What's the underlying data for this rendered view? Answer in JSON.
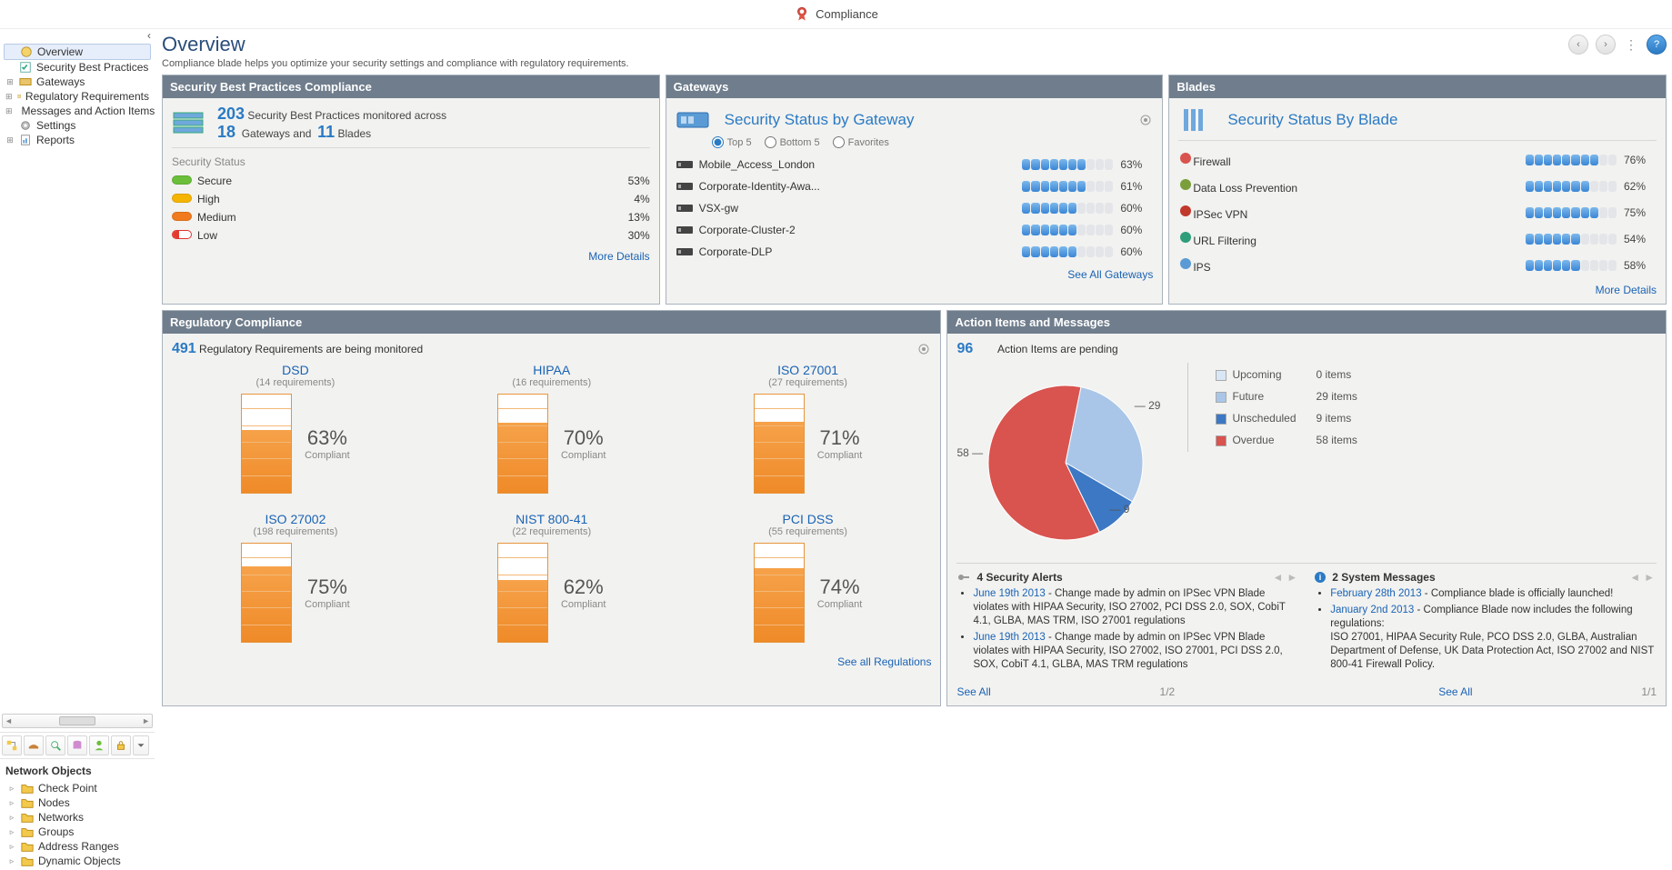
{
  "app": {
    "title": "Compliance"
  },
  "nav": {
    "items": [
      {
        "label": "Overview",
        "selected": true
      },
      {
        "label": "Security Best Practices"
      },
      {
        "label": "Gateways"
      },
      {
        "label": "Regulatory Requirements"
      },
      {
        "label": "Messages and Action Items"
      },
      {
        "label": "Settings"
      },
      {
        "label": "Reports"
      }
    ]
  },
  "network_objects": {
    "heading": "Network Objects",
    "items": [
      "Check Point",
      "Nodes",
      "Networks",
      "Groups",
      "Address Ranges",
      "Dynamic Objects"
    ]
  },
  "page": {
    "title": "Overview",
    "subtitle": "Compliance blade helps you optimize your security settings and compliance with regulatory requirements."
  },
  "sbp": {
    "panel_title": "Security Best Practices Compliance",
    "count": "203",
    "count_text": "Security Best Practices monitored across",
    "gateways": "18",
    "gateways_text": "Gateways and",
    "blades": "11",
    "blades_text": "Blades",
    "status_label": "Security Status",
    "rows": [
      {
        "label": "Secure",
        "pct": "53%",
        "cls": "green"
      },
      {
        "label": "High",
        "pct": "4%",
        "cls": "yellow"
      },
      {
        "label": "Medium",
        "pct": "13%",
        "cls": "orange"
      },
      {
        "label": "Low",
        "pct": "30%",
        "cls": "red-low"
      }
    ],
    "more": "More Details"
  },
  "gateways": {
    "panel_title": "Gateways",
    "subtitle": "Security Status by Gateway",
    "filters": {
      "top5": "Top 5",
      "bottom5": "Bottom 5",
      "favorites": "Favorites"
    },
    "rows": [
      {
        "name": "Mobile_Access_London",
        "pct": "63%",
        "seg": 7
      },
      {
        "name": "Corporate-Identity-Awa...",
        "pct": "61%",
        "seg": 7
      },
      {
        "name": "VSX-gw",
        "pct": "60%",
        "seg": 6
      },
      {
        "name": "Corporate-Cluster-2",
        "pct": "60%",
        "seg": 6
      },
      {
        "name": "Corporate-DLP",
        "pct": "60%",
        "seg": 6
      }
    ],
    "link": "See All Gateways"
  },
  "blades": {
    "panel_title": "Blades",
    "subtitle": "Security Status By Blade",
    "rows": [
      {
        "name": "Firewall",
        "pct": "76%",
        "seg": 8,
        "color": "#d9534f"
      },
      {
        "name": "Data Loss Prevention",
        "pct": "62%",
        "seg": 7,
        "color": "#7a9e3a"
      },
      {
        "name": "IPSec VPN",
        "pct": "75%",
        "seg": 8,
        "color": "#c0392b"
      },
      {
        "name": "URL Filtering",
        "pct": "54%",
        "seg": 6,
        "color": "#2e9e7a"
      },
      {
        "name": "IPS",
        "pct": "58%",
        "seg": 6,
        "color": "#5b9bd5"
      }
    ],
    "link": "More Details"
  },
  "regulatory": {
    "panel_title": "Regulatory Compliance",
    "count": "491",
    "count_text": "Regulatory Requirements are being monitored",
    "items": [
      {
        "name": "DSD",
        "req": "(14 requirements)",
        "pct": 63,
        "pct_label": "63%",
        "sub": "Compliant"
      },
      {
        "name": "HIPAA",
        "req": "(16 requirements)",
        "pct": 70,
        "pct_label": "70%",
        "sub": "Compliant"
      },
      {
        "name": "ISO 27001",
        "req": "(27 requirements)",
        "pct": 71,
        "pct_label": "71%",
        "sub": "Compliant"
      },
      {
        "name": "ISO 27002",
        "req": "(198 requirements)",
        "pct": 75,
        "pct_label": "75%",
        "sub": "Compliant"
      },
      {
        "name": "NIST 800-41",
        "req": "(22 requirements)",
        "pct": 62,
        "pct_label": "62%",
        "sub": "Compliant"
      },
      {
        "name": "PCI DSS",
        "req": "(55 requirements)",
        "pct": 74,
        "pct_label": "74%",
        "sub": "Compliant"
      }
    ],
    "link": "See all Regulations"
  },
  "action_items": {
    "panel_title": "Action Items and Messages",
    "count": "96",
    "count_text": "Action Items are pending",
    "legend": [
      {
        "name": "Upcoming",
        "value": "0 items",
        "color": "#d9e6f5"
      },
      {
        "name": "Future",
        "value": "29 items",
        "color": "#a9c6e8"
      },
      {
        "name": "Unscheduled",
        "value": "9 items",
        "color": "#3c78c3"
      },
      {
        "name": "Overdue",
        "value": "58 items",
        "color": "#d9534f"
      }
    ],
    "pie_labels": {
      "future": "29",
      "unscheduled": "9",
      "overdue": "58"
    },
    "alerts": {
      "title": "4 Security Alerts",
      "items": [
        {
          "date": "June 19th 2013",
          "text": "Change made by admin on IPSec VPN Blade violates with HIPAA Security, ISO 27002, PCI DSS 2.0, SOX, CobiT 4.1, GLBA, MAS TRM, ISO 27001 regulations"
        },
        {
          "date": "June 19th 2013",
          "text": "Change made by admin on IPSec VPN Blade violates with HIPAA Security, ISO 27002, ISO 27001, PCI DSS 2.0, SOX, CobiT 4.1, GLBA, MAS TRM regulations"
        }
      ],
      "page": "1/2",
      "see_all": "See All"
    },
    "messages": {
      "title": "2 System Messages",
      "items": [
        {
          "date": "February 28th 2013",
          "text": "Compliance blade is officially launched!"
        },
        {
          "date": "January 2nd 2013",
          "text": "Compliance Blade now includes the following regulations:\nISO 27001, HIPAA Security Rule, PCO DSS 2.0, GLBA, Australian Department of Defense, UK Data Protection Act, ISO 27002 and NIST 800-41 Firewall Policy."
        }
      ],
      "page": "1/1",
      "see_all": "See All"
    }
  },
  "chart_data": {
    "type": "pie",
    "title": "Action Items",
    "series": [
      {
        "name": "Upcoming",
        "value": 0,
        "color": "#d9e6f5"
      },
      {
        "name": "Future",
        "value": 29,
        "color": "#a9c6e8"
      },
      {
        "name": "Unscheduled",
        "value": 9,
        "color": "#3c78c3"
      },
      {
        "name": "Overdue",
        "value": 58,
        "color": "#d9534f"
      }
    ],
    "total": 96
  }
}
